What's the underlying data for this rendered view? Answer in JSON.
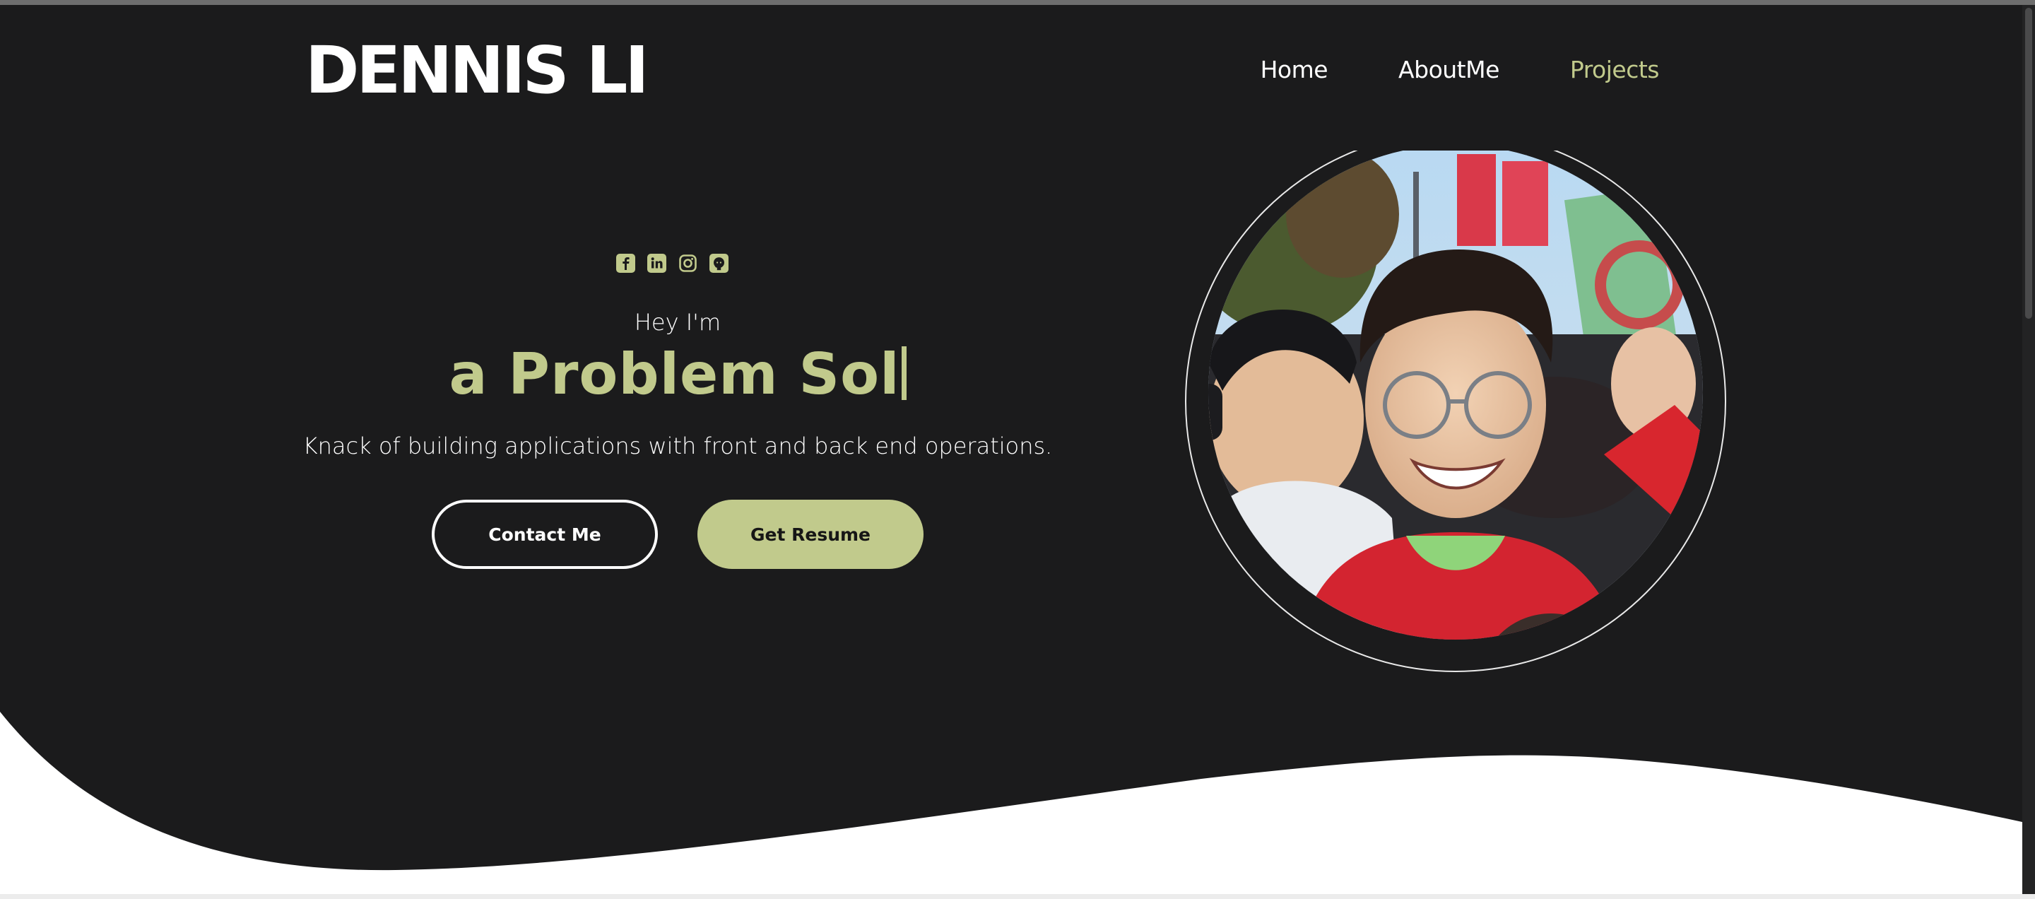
{
  "brand": {
    "name": "DENNIS LI"
  },
  "nav": {
    "home": "Home",
    "about": "AboutMe",
    "projects": "Projects"
  },
  "social": [
    "facebook-icon",
    "linkedin-icon",
    "instagram-icon",
    "github-icon"
  ],
  "hero": {
    "greeting": "Hey I'm",
    "role_typed": "a Problem Sol",
    "tagline": "Knack of building applications with front and back end operations.",
    "contact_label": "Contact Me",
    "resume_label": "Get Resume"
  },
  "colors": {
    "background": "#1b1b1c",
    "accent": "#c1ca8c",
    "text": "#ffffff",
    "wave": "#ffffff"
  }
}
